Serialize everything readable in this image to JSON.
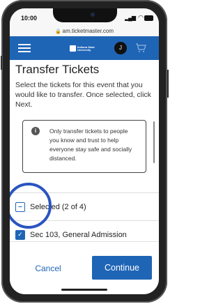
{
  "status": {
    "time": "10:00"
  },
  "browser": {
    "url": "am.ticketmaster.com"
  },
  "nav": {
    "logo_line1": "Indiana State",
    "logo_line2": "University",
    "avatar_initial": "J"
  },
  "page": {
    "title": "Transfer Tickets",
    "instructions": "Select the tickets for this event that you would like to transfer. Once selected, click Next.",
    "notice": "Only transfer tickets to people you know and trust to help everyone stay safe and socially distanced."
  },
  "selection": {
    "selected_label": "Selected (2 of 4)",
    "ticket_label": "Sec 103, General Admission"
  },
  "actions": {
    "cancel": "Cancel",
    "continue": "Continue"
  },
  "colors": {
    "brand_blue": "#1f65b6",
    "highlight_circle": "#2a55c0"
  }
}
